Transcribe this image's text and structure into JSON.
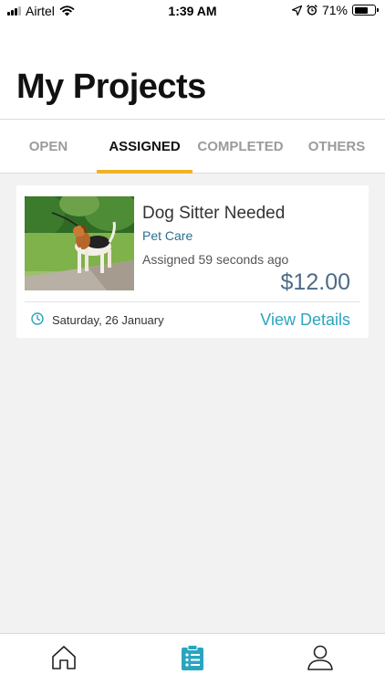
{
  "status_bar": {
    "carrier": "Airtel",
    "time": "1:39 AM",
    "battery": "71%",
    "battery_level": 0.71
  },
  "header": {
    "title": "My Projects"
  },
  "tabs": [
    {
      "label": "OPEN",
      "active": false
    },
    {
      "label": "ASSIGNED",
      "active": true
    },
    {
      "label": "COMPLETED",
      "active": false
    },
    {
      "label": "OTHERS",
      "active": false
    }
  ],
  "colors": {
    "accent": "#f0b323",
    "link": "#2aa5bf",
    "category": "#2a6f8e",
    "price": "#4d6b86"
  },
  "projects": [
    {
      "title": "Dog Sitter Needed",
      "category": "Pet Care",
      "assigned": "Assigned 59 seconds ago",
      "price": "$12.00",
      "date": "Saturday, 26 January",
      "action": "View Details",
      "icon": "clock-icon"
    }
  ],
  "bottom_nav": [
    {
      "name": "home",
      "icon": "home-icon",
      "active": false
    },
    {
      "name": "projects",
      "icon": "projects-list-icon",
      "active": true
    },
    {
      "name": "profile",
      "icon": "profile-icon",
      "active": false
    }
  ]
}
